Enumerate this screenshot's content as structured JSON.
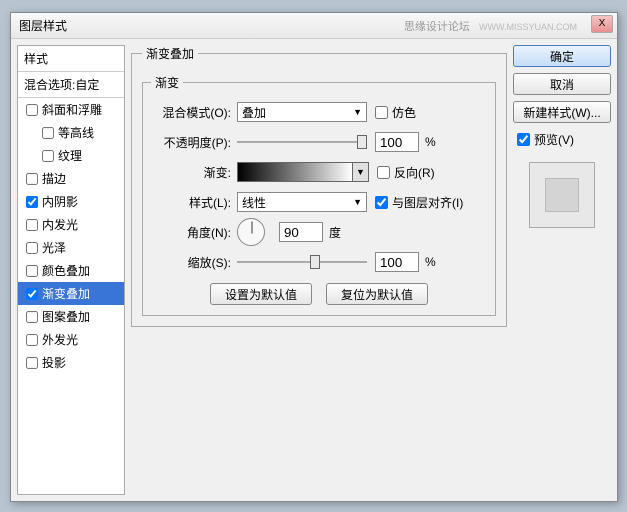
{
  "title": "图层样式",
  "watermark": "思缘设计论坛",
  "watermark_url": "WWW.MISSYUAN.COM",
  "close": "X",
  "left": {
    "header": "样式",
    "sub": "混合选项:自定",
    "items": [
      {
        "label": "斜面和浮雕",
        "checked": false,
        "sub": false
      },
      {
        "label": "等高线",
        "checked": false,
        "sub": true
      },
      {
        "label": "纹理",
        "checked": false,
        "sub": true
      },
      {
        "label": "描边",
        "checked": false,
        "sub": false
      },
      {
        "label": "内阴影",
        "checked": true,
        "sub": false
      },
      {
        "label": "内发光",
        "checked": false,
        "sub": false
      },
      {
        "label": "光泽",
        "checked": false,
        "sub": false
      },
      {
        "label": "颜色叠加",
        "checked": false,
        "sub": false
      },
      {
        "label": "渐变叠加",
        "checked": true,
        "sub": false,
        "selected": true
      },
      {
        "label": "图案叠加",
        "checked": false,
        "sub": false
      },
      {
        "label": "外发光",
        "checked": false,
        "sub": false
      },
      {
        "label": "投影",
        "checked": false,
        "sub": false
      }
    ]
  },
  "center": {
    "title": "渐变叠加",
    "inner_title": "渐变",
    "blend_label": "混合模式(O):",
    "blend_value": "叠加",
    "dither_label": "仿色",
    "opacity_label": "不透明度(P):",
    "opacity_value": "100",
    "percent": "%",
    "gradient_label": "渐变:",
    "reverse_label": "反向(R)",
    "style_label": "样式(L):",
    "style_value": "线性",
    "align_label": "与图层对齐(I)",
    "angle_label": "角度(N):",
    "angle_value": "90",
    "degree": "度",
    "scale_label": "缩放(S):",
    "scale_value": "100",
    "btn_default": "设置为默认值",
    "btn_reset": "复位为默认值"
  },
  "right": {
    "ok": "确定",
    "cancel": "取消",
    "newstyle": "新建样式(W)...",
    "preview": "预览(V)"
  }
}
